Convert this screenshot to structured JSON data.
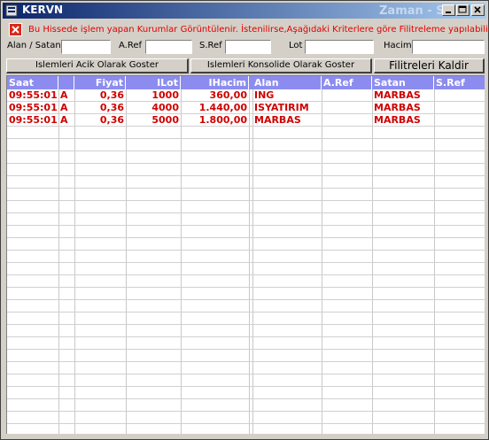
{
  "window": {
    "title": "KERVN",
    "title_right": "Zaman - Satis"
  },
  "info": {
    "text": "Bu Hissede işlem yapan Kurumlar Görüntülenir. İstenilirse,Aşağıdaki Kriterlere göre Filitreleme yapılabilir."
  },
  "filters": {
    "alan_satan_label": "Alan / Satan",
    "aref_label": "A.Ref",
    "sref_label": "S.Ref",
    "lot_label": "Lot",
    "hacim_label": "Hacim",
    "alan_satan_value": "",
    "aref_value": "",
    "sref_value": "",
    "lot_value": "",
    "hacim_value": ""
  },
  "buttons": {
    "acik": "Islemleri Acik Olarak Goster",
    "konsolide": "Islemleri Konsolide Olarak Goster",
    "kaldir": "Filitreleri Kaldir"
  },
  "table": {
    "headers": [
      "Saat",
      "",
      "Fiyat",
      "ILot",
      "IHacim",
      "Alan",
      "A.Ref",
      "Satan",
      "S.Ref"
    ],
    "rows": [
      [
        "09:55:01",
        "A",
        "0,36",
        "1000",
        "360,00",
        "ING",
        "",
        "MARBAS",
        ""
      ],
      [
        "09:55:01",
        "A",
        "0,36",
        "4000",
        "1.440,00",
        "ISYATIRIM",
        "",
        "MARBAS",
        ""
      ],
      [
        "09:55:01",
        "A",
        "0,36",
        "5000",
        "1.800,00",
        "MARBAS",
        "",
        "MARBAS",
        ""
      ]
    ]
  },
  "colors": {
    "header_bg": "#8c8cf0",
    "row_text": "#d00000",
    "info_text": "#e00000"
  }
}
